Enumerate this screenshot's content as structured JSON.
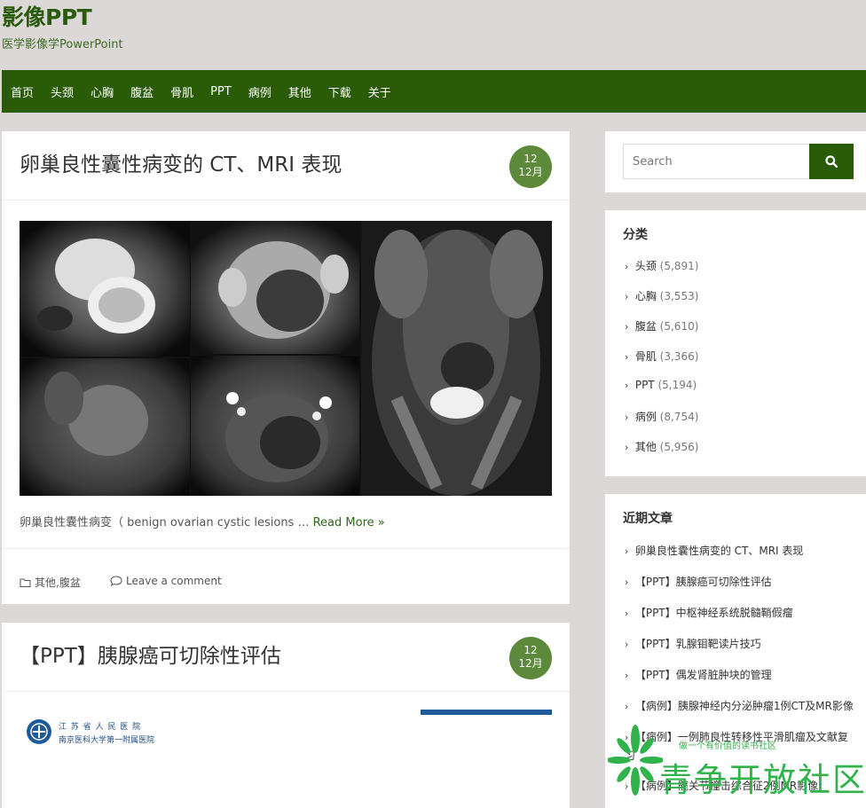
{
  "site": {
    "title": "影像PPT",
    "description": "医学影像学PowerPoint"
  },
  "nav": [
    "首页",
    "头颈",
    "心胸",
    "腹盆",
    "骨肌",
    "PPT",
    "病例",
    "其他",
    "下载",
    "关于"
  ],
  "posts": [
    {
      "title": "卵巢良性囊性病变的 CT、MRI 表现",
      "date_day": "12",
      "date_month": "12月",
      "excerpt": "卵巢良性囊性病变（ benign ovarian cystic lesions …",
      "read_more": "Read More »",
      "categories_prefix": "其他",
      "categories_sep": ", ",
      "categories_second": "腹盆",
      "comment": "Leave a comment"
    },
    {
      "title": "【PPT】胰腺癌可切除性评估",
      "date_day": "12",
      "date_month": "12月",
      "hospital_line1": "江 苏 省 人 民 医 院",
      "hospital_line2": "南京医科大学第一附属医院"
    }
  ],
  "search": {
    "placeholder": "Search"
  },
  "categories": {
    "title": "分类",
    "items": [
      {
        "name": "头颈",
        "count": "(5,891)"
      },
      {
        "name": "心胸",
        "count": "(3,553)"
      },
      {
        "name": "腹盆",
        "count": "(5,610)"
      },
      {
        "name": "骨肌",
        "count": "(3,366)"
      },
      {
        "name": "PPT",
        "count": "(5,194)"
      },
      {
        "name": "病例",
        "count": "(8,754)"
      },
      {
        "name": "其他",
        "count": "(5,956)"
      }
    ]
  },
  "recent": {
    "title": "近期文章",
    "items": [
      "卵巢良性囊性病变的 CT、MRI 表现",
      "【PPT】胰腺癌可切除性评估",
      "【PPT】中枢神经系统脱髓鞘假瘤",
      "【PPT】乳腺钼靶读片技巧",
      "【PPT】偶发肾脏肿块的管理",
      "【病例】胰腺神经内分泌肿瘤1例CT及MR影像",
      "【病例】一例肺良性转移性平滑肌瘤及文献复习",
      "【病例】髋关节撞击综合征2例MR影像"
    ]
  },
  "watermark": {
    "big": "青争开放社区",
    "small": "做一个有价值的读书社区"
  },
  "colors": {
    "accent": "#2a5c07",
    "badge": "#5c8a3a",
    "watermark": "#2fb34a"
  }
}
